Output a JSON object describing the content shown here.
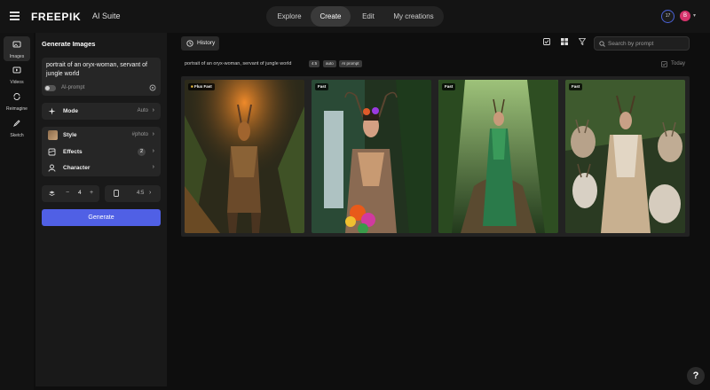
{
  "app": {
    "logo_text": "FREEPIK",
    "logo_sub": "AI Suite"
  },
  "nav": {
    "tabs": [
      {
        "label": "Explore",
        "active": false
      },
      {
        "label": "Create",
        "active": true
      },
      {
        "label": "Edit",
        "active": false
      },
      {
        "label": "My creations",
        "active": false
      }
    ]
  },
  "account": {
    "credits_badge": "17",
    "avatar_initial": "B"
  },
  "rail": {
    "items": [
      {
        "label": "Images",
        "icon": "image-stack-icon",
        "active": true
      },
      {
        "label": "Videos",
        "icon": "video-icon",
        "active": false
      },
      {
        "label": "Reimagine",
        "icon": "reimagine-icon",
        "active": false
      },
      {
        "label": "Sketch",
        "icon": "pen-icon",
        "active": false
      }
    ]
  },
  "panel": {
    "title": "Generate Images",
    "prompt": "portrait of an oryx-woman, servant of jungle world",
    "ai_prompt_label": "AI-prompt",
    "mode": {
      "label": "Mode",
      "value": "Auto"
    },
    "style": {
      "label": "Style",
      "value": "#photo"
    },
    "effects": {
      "label": "Effects",
      "count": "2"
    },
    "character": {
      "label": "Character"
    },
    "image_count": {
      "minus": "−",
      "value": "4",
      "plus": "+"
    },
    "aspect_ratio": "4:5",
    "generate_label": "Generate"
  },
  "main": {
    "history_label": "History",
    "search_placeholder": "Search by prompt",
    "generation": {
      "prompt": "portrait of an oryx-woman, servant of jungle world",
      "tags": [
        "4:5",
        "auto",
        "AI prompt"
      ]
    },
    "today_label": "Today",
    "images": [
      {
        "model_label": "Flux Fast",
        "has_flag": true
      },
      {
        "model_label": "Fast",
        "has_flag": false
      },
      {
        "model_label": "Fast",
        "has_flag": false
      },
      {
        "model_label": "Fast",
        "has_flag": false
      }
    ]
  },
  "help_label": "?",
  "colors": {
    "accent": "#5060e5",
    "background": "#0e0e0e",
    "panel": "#191919",
    "avatar": "#d6336c"
  }
}
